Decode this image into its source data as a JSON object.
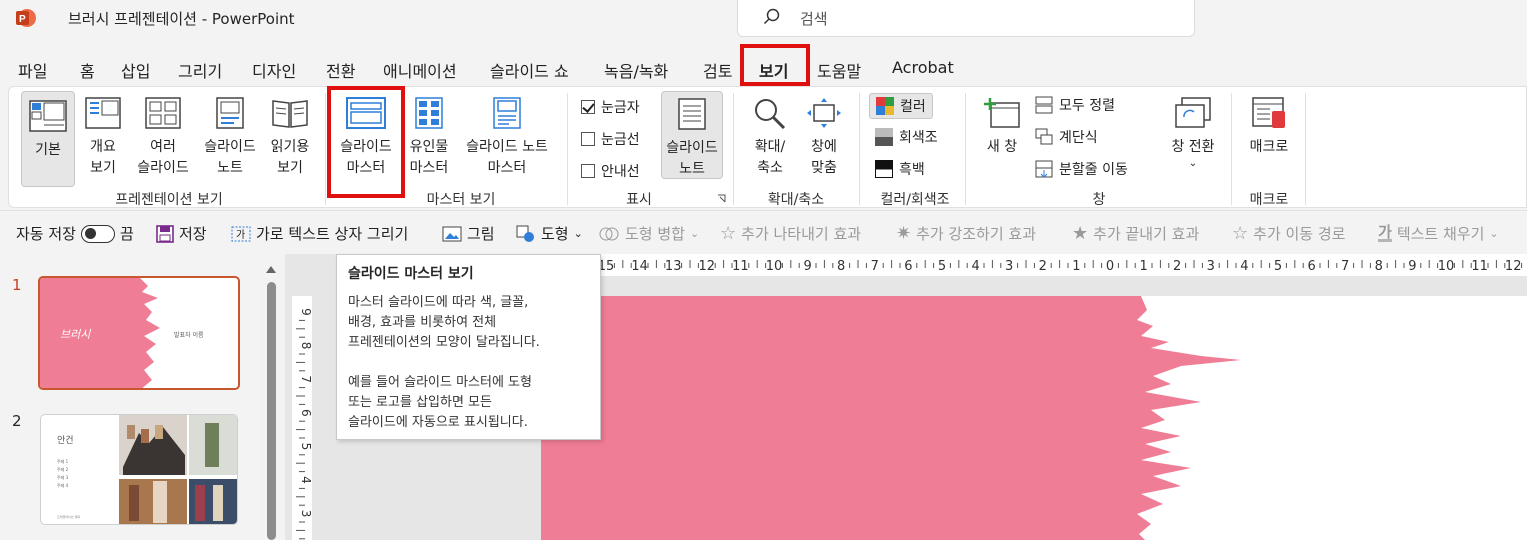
{
  "titlebar": {
    "doc_title": "브러시 프레젠테이션  -  PowerPoint",
    "search_placeholder": "검색"
  },
  "menu": [
    "파일",
    "홈",
    "삽입",
    "그리기",
    "디자인",
    "전환",
    "애니메이션",
    "슬라이드 쇼",
    "녹음/녹화",
    "검토",
    "보기",
    "도움말",
    "Acrobat"
  ],
  "ribbon": {
    "presentation_views": {
      "group": "프레젠테이션 보기",
      "normal": "기본",
      "outline": [
        "개요",
        "보기"
      ],
      "sorter": [
        "여러",
        "슬라이드"
      ],
      "notes_page": [
        "슬라이드",
        "노트"
      ],
      "reading": [
        "읽기용",
        "보기"
      ]
    },
    "master_views": {
      "group": "마스터 보기",
      "slide_master": [
        "슬라이드",
        "마스터"
      ],
      "handout_master": [
        "유인물",
        "마스터"
      ],
      "notes_master": [
        "슬라이드 노트",
        "마스터"
      ]
    },
    "show": {
      "group": "표시",
      "ruler": "눈금자",
      "gridlines": "눈금선",
      "guides": "안내선",
      "notes": [
        "슬라이드",
        "노트"
      ]
    },
    "zoom": {
      "group": "확대/축소",
      "zoom": [
        "확대/",
        "축소"
      ],
      "fit": [
        "창에",
        "맞춤"
      ]
    },
    "color": {
      "group": "컬러/회색조",
      "color": "컬러",
      "grayscale": "회색조",
      "bw": "흑백"
    },
    "window": {
      "group": "창",
      "new_window": "새 창",
      "arrange_all": "모두 정렬",
      "cascade": "계단식",
      "move_split": "분할줄 이동",
      "switch": "창 전환"
    },
    "macros": {
      "group": "매크로",
      "macros": "매크로"
    }
  },
  "qat": {
    "autosave": "자동 저장",
    "autosave_state": "끔",
    "save": "저장",
    "textbox": "가로 텍스트 상자 그리기",
    "picture": "그림",
    "shapes": "도형",
    "merge": "도형 병합",
    "entrance": "추가 나타내기 효과",
    "emphasis": "추가 강조하기 효과",
    "exit": "추가 끝내기 효과",
    "path": "추가 이동 경로",
    "textfill": "텍스트 채우기"
  },
  "slides": [
    {
      "num": "1",
      "title": "브러시",
      "subtitle": "발표자 이름"
    },
    {
      "num": "2",
      "title": "안건",
      "items": [
        "주제 1",
        "주제 2",
        "주제 3",
        "주제 4"
      ],
      "footer": "프레젠테이션 제목"
    }
  ],
  "ruler": {
    "h": [
      "15",
      "14",
      "13",
      "12",
      "11",
      "10",
      "9",
      "8",
      "7",
      "6",
      "5",
      "4",
      "3",
      "2",
      "1",
      "0",
      "1",
      "2",
      "3",
      "4",
      "5",
      "6",
      "7",
      "8",
      "9",
      "10",
      "11",
      "12"
    ],
    "v": [
      "9",
      "8",
      "7",
      "6",
      "5",
      "4",
      "3"
    ]
  },
  "tooltip": {
    "title": "슬라이드 마스터 보기",
    "body1": [
      "마스터 슬라이드에 따라 색, 글꼴,",
      "배경, 효과를 비롯하여 전체",
      "프레젠테이션의 모양이 달라집니다."
    ],
    "body2": [
      "예를 들어 슬라이드 마스터에 도형",
      "또는 로고를 삽입하면 모든",
      "슬라이드에 자동으로 표시됩니다."
    ]
  },
  "colors": {
    "accent": "#c43e1c",
    "highlight": "#e01010",
    "pink": "#ef7d95"
  }
}
